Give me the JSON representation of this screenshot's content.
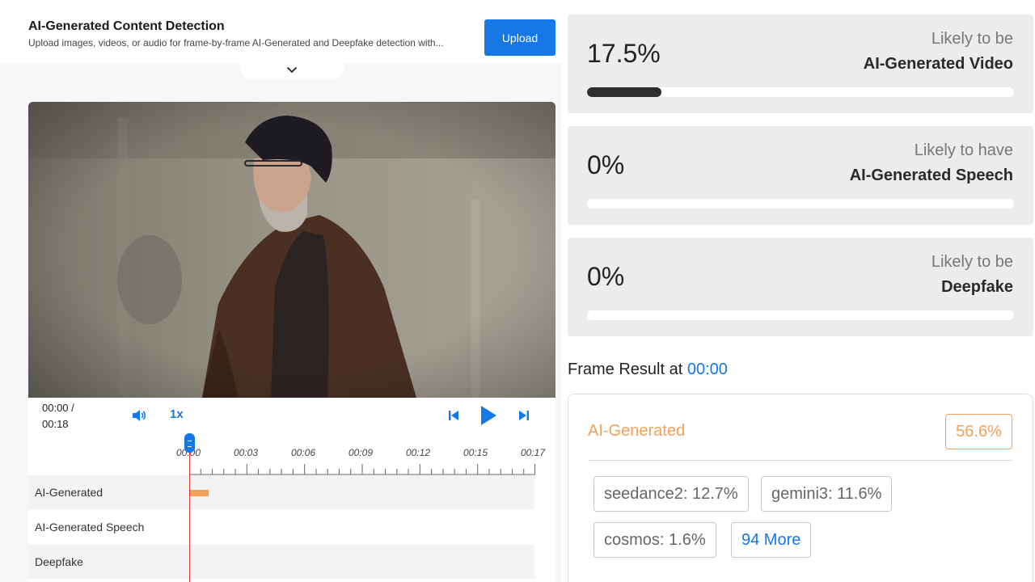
{
  "header": {
    "title": "AI-Generated Content Detection",
    "subtitle": "Upload images, videos, or audio for frame-by-frame AI-Generated and Deepfake detection with...",
    "upload_label": "Upload"
  },
  "player": {
    "current_time": "00:00 /",
    "duration": "00:18",
    "speed": "1x"
  },
  "timeline": {
    "ticks": [
      "00:00",
      "00:03",
      "00:06",
      "00:09",
      "00:12",
      "00:15",
      "00:17"
    ],
    "tracks": [
      "AI-Generated",
      "AI-Generated Speech",
      "Deepfake"
    ]
  },
  "summary": [
    {
      "percent": "17.5%",
      "label_line1": "Likely to be",
      "label_line2": "AI-Generated Video",
      "progress": 0.175
    },
    {
      "percent": "0%",
      "label_line1": "Likely to have",
      "label_line2": "AI-Generated Speech",
      "progress": 0
    },
    {
      "percent": "0%",
      "label_line1": "Likely to be",
      "label_line2": "Deepfake",
      "progress": 0
    }
  ],
  "frame_result": {
    "title_prefix": "Frame Result at",
    "timestamp": "00:00",
    "label": "AI-Generated",
    "score": "56.6%",
    "models": [
      "seedance2: 12.7%",
      "gemini3: 11.6%",
      "cosmos: 1.6%"
    ],
    "more_label": "94 More"
  },
  "colors": {
    "accent": "#1677e6",
    "ai_generated": "#f2a05a",
    "playhead": "#d9423a",
    "progress_fill": "#2f2f2f"
  }
}
